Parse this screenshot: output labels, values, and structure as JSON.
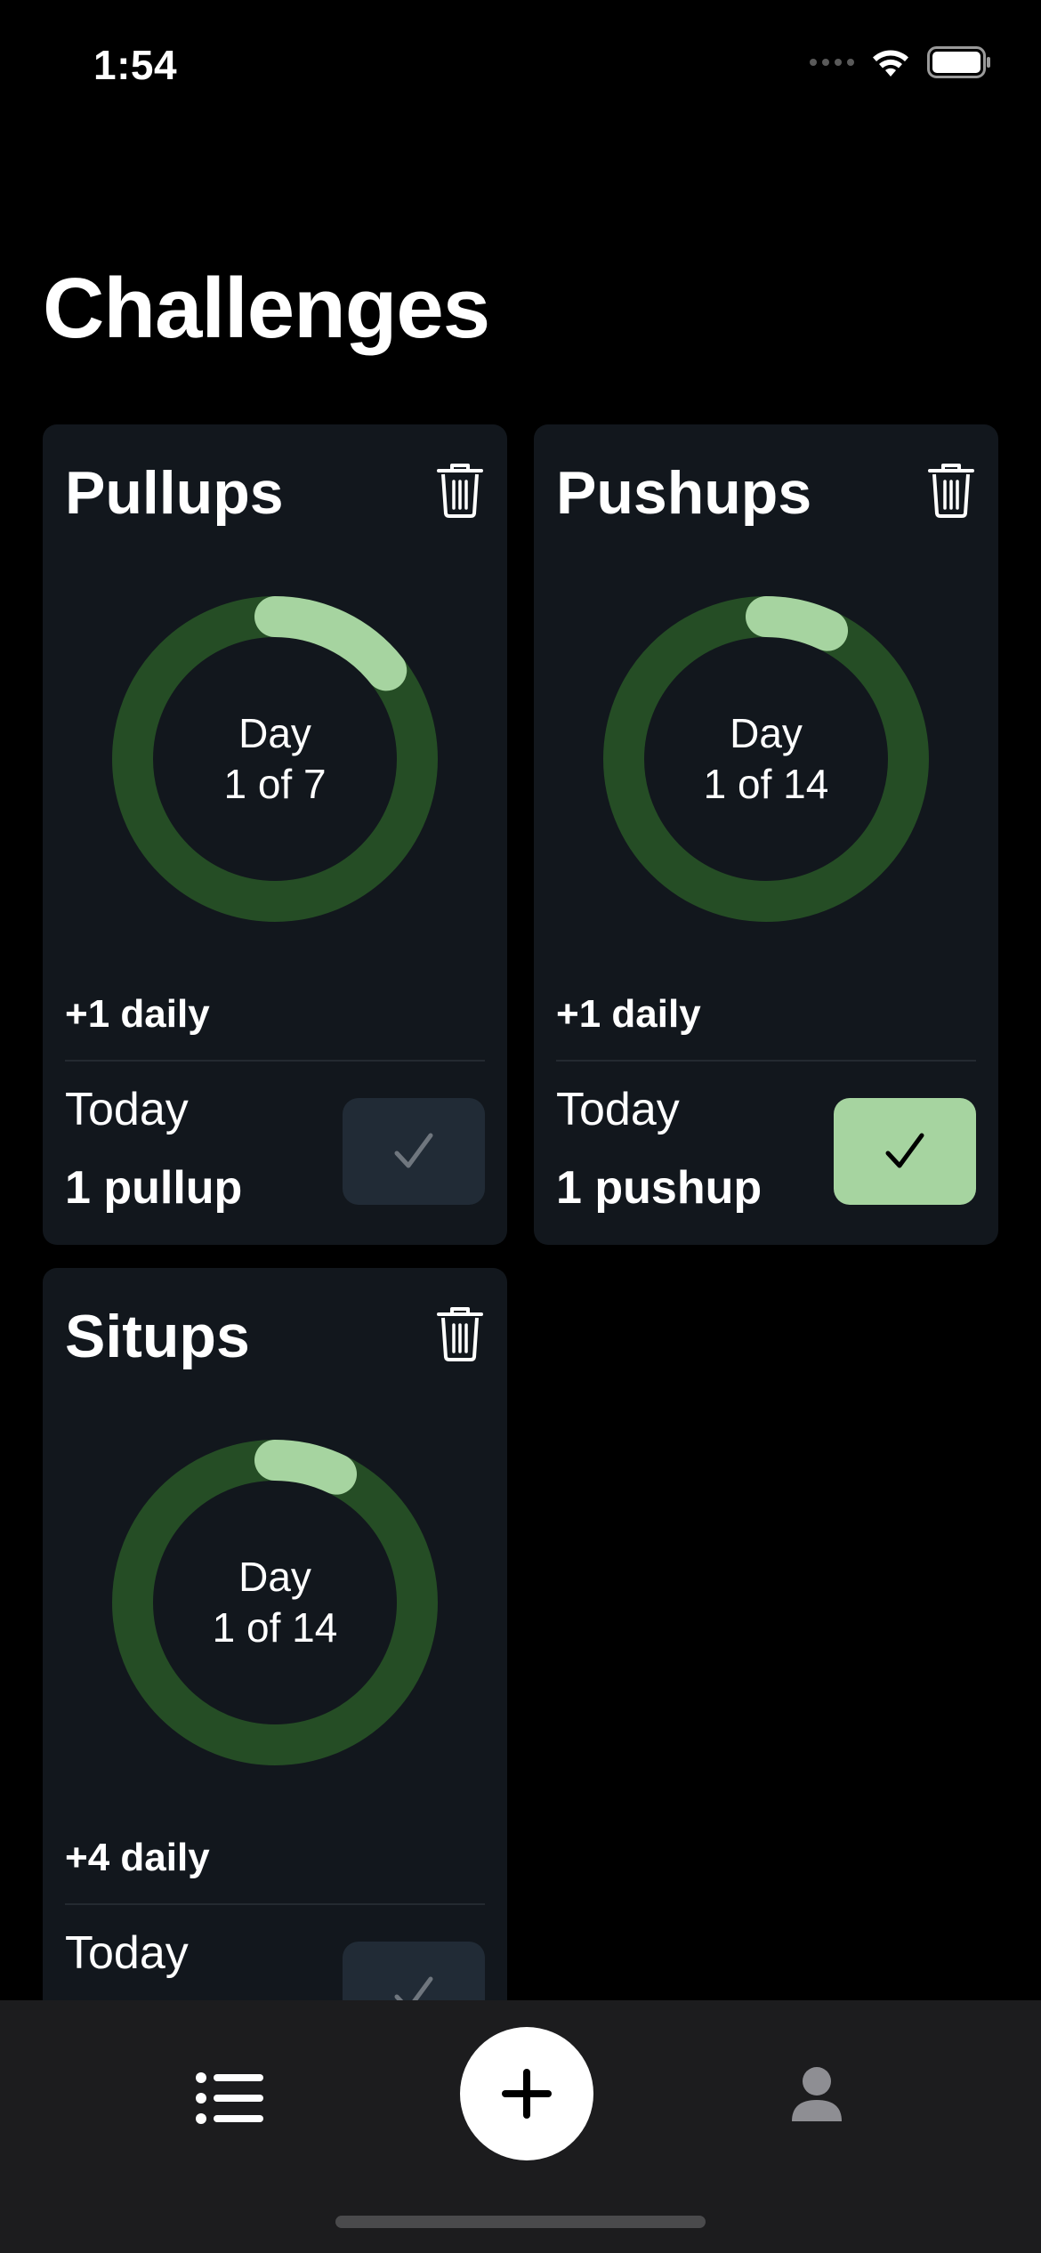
{
  "status_bar": {
    "time": "1:54"
  },
  "page": {
    "title": "Challenges"
  },
  "colors": {
    "card_bg": "#12171d",
    "ring_track": "#254d25",
    "ring_progress": "#a6d4a0",
    "check_done_bg": "#a6d4a0",
    "check_pending_bg": "#212b36"
  },
  "challenges": [
    {
      "name": "Pullups",
      "day_label": "Day",
      "day_progress": "1 of 7",
      "progress_fraction": 0.143,
      "daily_increment": "+1 daily",
      "today_label": "Today",
      "today_amount": "1 pullup",
      "completed": false
    },
    {
      "name": "Pushups",
      "day_label": "Day",
      "day_progress": "1 of 14",
      "progress_fraction": 0.071,
      "daily_increment": "+1 daily",
      "today_label": "Today",
      "today_amount": "1 pushup",
      "completed": true
    },
    {
      "name": "Situps",
      "day_label": "Day",
      "day_progress": "1 of 14",
      "progress_fraction": 0.071,
      "daily_increment": "+4 daily",
      "today_label": "Today",
      "today_amount": "",
      "completed": false
    }
  ],
  "icons": {
    "delete": "trash-icon",
    "complete": "checkmark-icon",
    "list_tab": "list-icon",
    "add_tab": "plus-icon",
    "profile_tab": "person-icon"
  }
}
